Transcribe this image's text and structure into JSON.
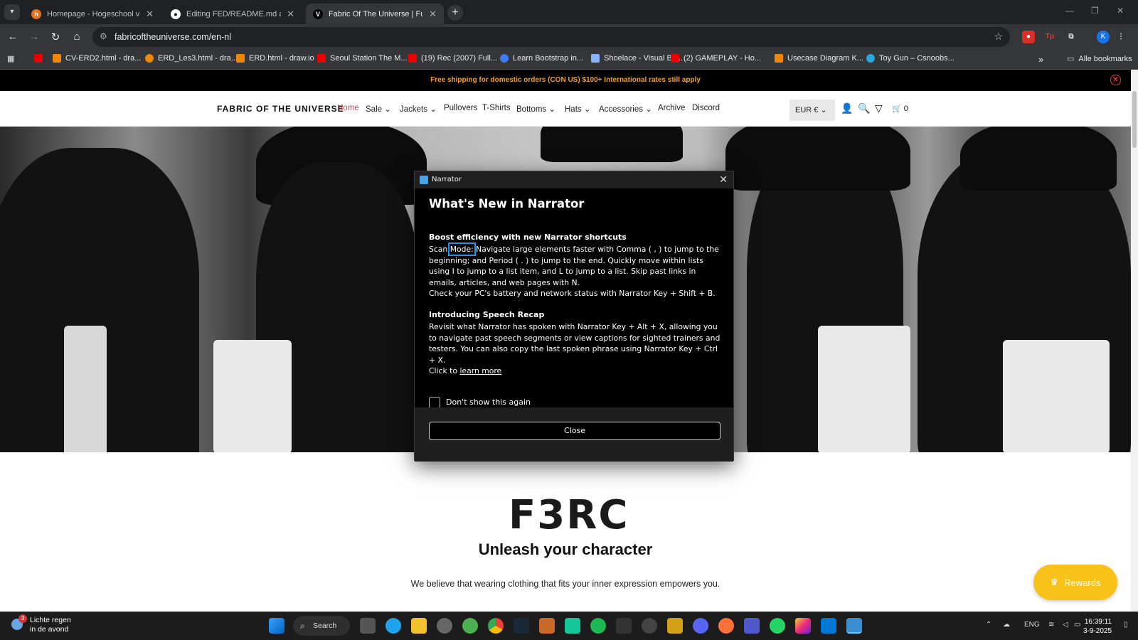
{
  "browser": {
    "tabs": [
      {
        "title": "Homepage - Hogeschool van A",
        "icon": "hva-icon",
        "active": false
      },
      {
        "title": "Editing FED/README.md at ma",
        "icon": "github-icon",
        "active": false
      },
      {
        "title": "Fabric Of The Universe | Future",
        "icon": "fotu-icon",
        "active": true
      }
    ],
    "url": "fabricoftheuniverse.com/en-nl",
    "profile_initial": "K",
    "bookmarks": [
      {
        "label": "",
        "icon": "youtube-icon"
      },
      {
        "label": "CV-ERD2.html - dra...",
        "icon": "drawio-icon"
      },
      {
        "label": "ERD_Les3.html - dra...",
        "icon": "drawio-icon"
      },
      {
        "label": "ERD.html - draw.io",
        "icon": "drawio-icon"
      },
      {
        "label": "Seoul Station The M...",
        "icon": "youtube-icon"
      },
      {
        "label": "(19) Rec (2007) Full...",
        "icon": "youtube-icon"
      },
      {
        "label": "Learn Bootstrap in...",
        "icon": "bootstrap-icon"
      },
      {
        "label": "Shoelace - Visual Bo...",
        "icon": "shoelace-icon"
      },
      {
        "label": "(2) GAMEPLAY - Ho...",
        "icon": "youtube-icon"
      },
      {
        "label": "Usecase Diagram K...",
        "icon": "drawio-icon"
      },
      {
        "label": "Toy Gun – Csnoobs...",
        "icon": "link-icon"
      }
    ],
    "all_bookmarks": "Alle bookmarks"
  },
  "site": {
    "promo": "Free shipping for domestic orders (CON US) $100+ International rates still apply",
    "logo": "FABRIC OF THE UNIVERSE",
    "nav": [
      "Home",
      "Sale",
      "Jackets",
      "Pullovers",
      "T-Shirts",
      "Bottoms",
      "Hats",
      "Accessories",
      "Archive",
      "Discord"
    ],
    "currency": "EUR €",
    "cart_count": "0",
    "brandmark": "F3RC",
    "tagline": "Unleash your character",
    "subline": "We believe that wearing clothing that fits your inner expression empowers you.",
    "rewards": "Rewards"
  },
  "narrator": {
    "window_title": "Narrator",
    "heading": "What's New in Narrator",
    "s1_title": "Boost efficiency with new Narrator shortcuts",
    "s1_pre": "Scan ",
    "s1_highlight": "Mode:",
    "s1_post": " Navigate large elements faster with Comma ( , ) to jump to the beginning; and Period ( . ) to jump to the end. Quickly move within lists using I to jump to a list item, and L to jump to a list. Skip past links in emails, articles, and web pages with N.",
    "s1_line2": "Check your PC's battery and network status with Narrator Key + Shift + B.",
    "s2_title": "Introducing Speech Recap",
    "s2_body": "Revisit what Narrator has spoken with Narrator Key + Alt + X, allowing you to navigate past speech segments or view captions for sighted trainers and testers. You can also copy the last spoken phrase using Narrator Key + Ctrl + X.",
    "click_to": "Click to ",
    "learn_more": "learn more",
    "dont_show": "Don't show this again",
    "close": "Close"
  },
  "taskbar": {
    "weather_line1": "Lichte regen",
    "weather_line2": "in de avond",
    "weather_badge": "3",
    "search": "Search",
    "lang": "ENG",
    "time": "16:39:11",
    "date": "3-9-2025"
  },
  "colors": {
    "promo_text": "#f0a030",
    "nav_active": "#e04040",
    "rewards_bg": "#f8c21b",
    "highlight": "#1e90ff"
  }
}
